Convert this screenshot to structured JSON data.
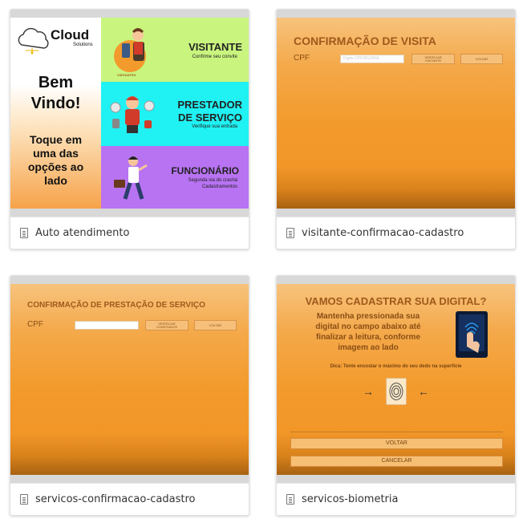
{
  "cards": [
    {
      "title": "Auto atendimento",
      "welcome": {
        "brand": "Cloud",
        "brand_sub": "Solutions",
        "greeting_line1": "Bem",
        "greeting_line2": "Vindo!",
        "instruction_line1": "Toque em",
        "instruction_line2": "uma das",
        "instruction_line3": "opções ao",
        "instruction_line4": "lado"
      },
      "options": [
        {
          "title": "VISITANTE",
          "subtitle": "Confirme seu convite",
          "badge": "VISITANTES",
          "color": "#c9f57e"
        },
        {
          "title_line1": "PRESTADOR",
          "title_line2": "DE SERVIÇO",
          "subtitle": "Verifique sua entrada",
          "color": "#20f1f3"
        },
        {
          "title": "FUNCIONÁRIO",
          "subtitle_line1": "Segunda via do crachá",
          "subtitle_line2": "Cadastramentos",
          "color": "#b873f3"
        }
      ]
    },
    {
      "title": "visitante-confirmacao-cadastro",
      "heading": "CONFIRMAÇÃO DE VISITA",
      "cpf_label": "CPF",
      "cpf_placeholder": "Digite CPF/RG/RNE",
      "confirm_line1": "VERIFICAR",
      "confirm_line2": "VISITANTE",
      "back_label": "VOLTAR"
    },
    {
      "title": "servicos-confirmacao-cadastro",
      "heading": "CONFIRMAÇÃO DE PRESTAÇÃO DE SERVIÇO",
      "cpf_label": "CPF",
      "confirm_line1": "VERIFICAR",
      "confirm_line2": "CONVITADOS",
      "back_label": "VOLTAR"
    },
    {
      "title": "servicos-biometria",
      "heading": "VAMOS CADASTRAR SUA DIGITAL?",
      "instruction_line1": "Mantenha pressionada sua",
      "instruction_line2": "digital no campo abaixo até",
      "instruction_line3": "finalizar a leitura, conforme",
      "instruction_line4": "imagem ao lado",
      "tip": "Dica: Tente encostar o máximo do seu dedo na superfície",
      "back_label": "VOLTAR",
      "cancel_label": "CANCELAR"
    }
  ],
  "colors": {
    "accent_orange": "#f39a2c",
    "heading_brown": "#a0591c",
    "navy": "#1e3a6b"
  }
}
